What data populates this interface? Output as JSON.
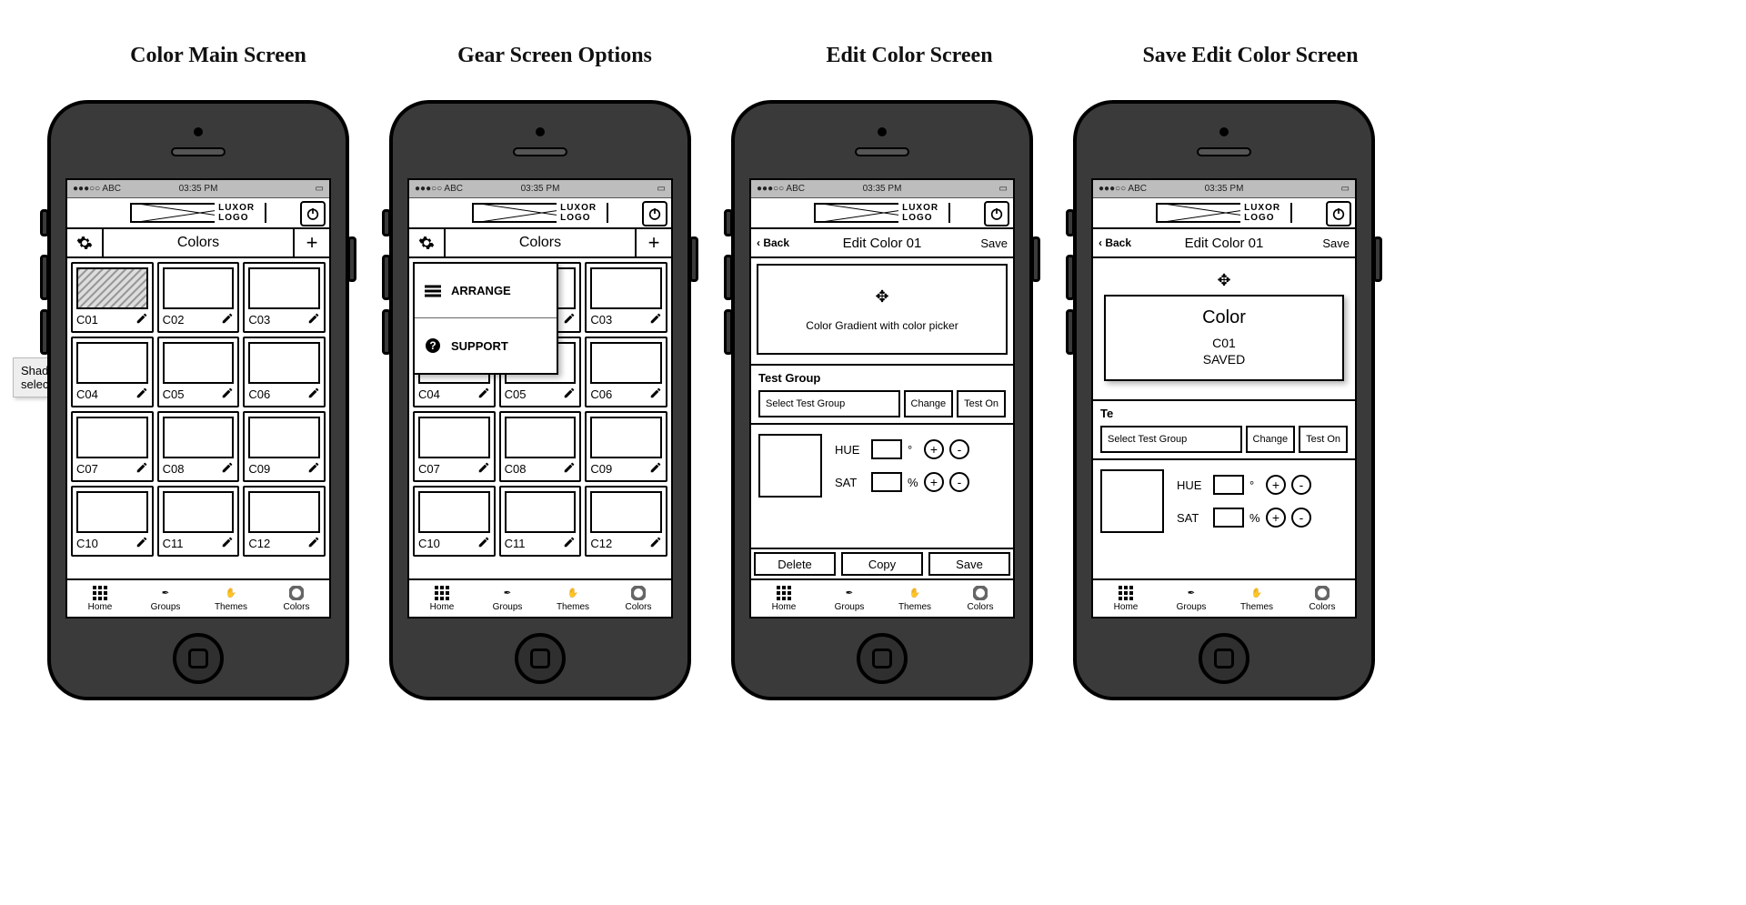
{
  "titles": [
    "Color Main Screen",
    "Gear Screen Options",
    "Edit Color Screen",
    "Save Edit Color Screen"
  ],
  "tooltip": "Shading indicates selected",
  "status": {
    "left": "●●●○○ ABC",
    "center": "03:35 PM",
    "battery": "▮"
  },
  "logo": "LUXOR LOGO",
  "colors_title": "Colors",
  "tiles": [
    "C01",
    "C02",
    "C03",
    "C04",
    "C05",
    "C06",
    "C07",
    "C08",
    "C09",
    "C10",
    "C11",
    "C12"
  ],
  "popover": {
    "arrange": "ARRANGE",
    "support": "SUPPORT"
  },
  "edit": {
    "back": "‹ Back",
    "title": "Edit Color 01",
    "save": "Save",
    "picker_text": "Color Gradient with color picker",
    "test_group_title": "Test Group",
    "select_placeholder": "Select Test Group",
    "change_btn": "Change",
    "teston_btn": "Test On",
    "hue_label": "HUE",
    "hue_unit": "°",
    "sat_label": "SAT",
    "sat_unit": "%",
    "delete": "Delete",
    "copy": "Copy",
    "save2": "Save"
  },
  "save_modal": {
    "title": "Color",
    "line1": "C01",
    "line2": "SAVED"
  },
  "tabs": {
    "home": "Home",
    "groups": "Groups",
    "themes": "Themes",
    "colors": "Colors"
  }
}
